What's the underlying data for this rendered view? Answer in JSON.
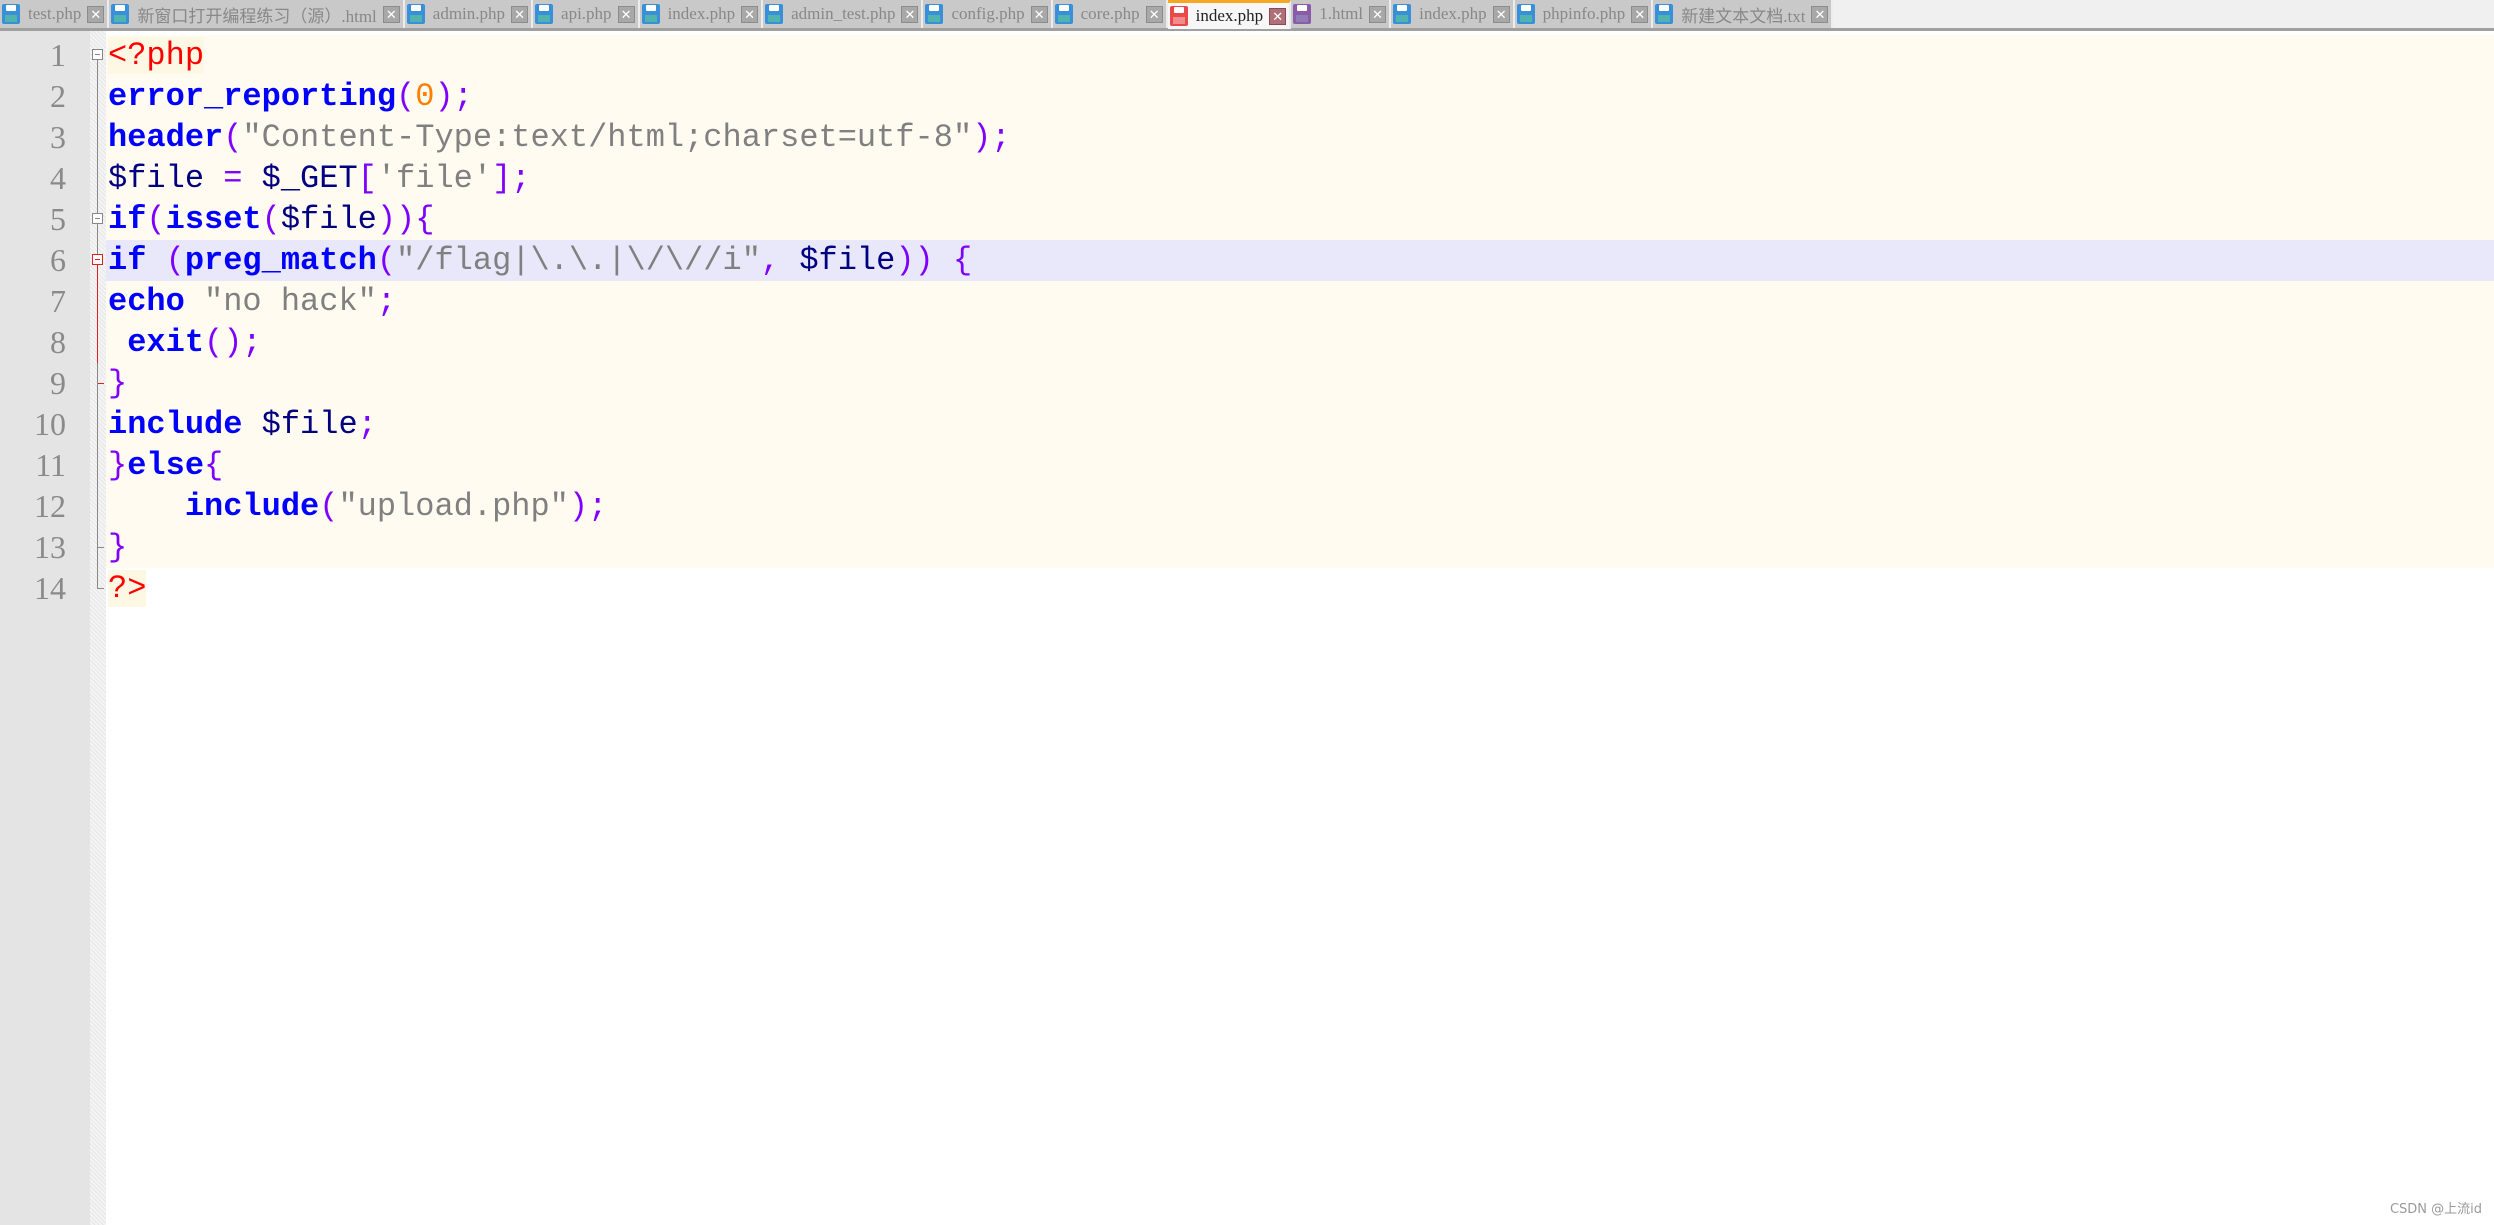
{
  "tabs": [
    {
      "name": "test.php",
      "icon": "floppy-disk-icon",
      "state": "saved"
    },
    {
      "name": "新窗口打开编程练习（源）.html",
      "icon": "floppy-disk-icon",
      "state": "saved"
    },
    {
      "name": "admin.php",
      "icon": "floppy-disk-icon",
      "state": "saved"
    },
    {
      "name": "api.php",
      "icon": "floppy-disk-icon",
      "state": "saved"
    },
    {
      "name": "index.php",
      "icon": "floppy-disk-icon",
      "state": "saved"
    },
    {
      "name": "admin_test.php",
      "icon": "floppy-disk-icon",
      "state": "saved"
    },
    {
      "name": "config.php",
      "icon": "floppy-disk-icon",
      "state": "saved"
    },
    {
      "name": "core.php",
      "icon": "floppy-disk-icon",
      "state": "saved"
    },
    {
      "name": "index.php",
      "icon": "floppy-disk-icon",
      "state": "unsaved-active"
    },
    {
      "name": "1.html",
      "icon": "floppy-disk-icon",
      "state": "readonly"
    },
    {
      "name": "index.php",
      "icon": "floppy-disk-icon",
      "state": "saved"
    },
    {
      "name": "phpinfo.php",
      "icon": "floppy-disk-icon",
      "state": "saved"
    },
    {
      "name": "新建文本文档.txt",
      "icon": "floppy-disk-icon",
      "state": "saved"
    }
  ],
  "active_tab_index": 8,
  "close_glyph": "✕",
  "editor": {
    "current_line": 6,
    "lines": [
      {
        "n": "1",
        "tokens": [
          {
            "t": "<?php",
            "c": "tag"
          }
        ]
      },
      {
        "n": "2",
        "tokens": [
          {
            "t": "error_reporting",
            "c": "kw"
          },
          {
            "t": "(",
            "c": "p"
          },
          {
            "t": "0",
            "c": "num"
          },
          {
            "t": ");",
            "c": "p"
          }
        ]
      },
      {
        "n": "3",
        "tokens": [
          {
            "t": "header",
            "c": "kw"
          },
          {
            "t": "(",
            "c": "p"
          },
          {
            "t": "\"Content-Type:text/html;charset=utf-8\"",
            "c": "str"
          },
          {
            "t": ");",
            "c": "p"
          }
        ]
      },
      {
        "n": "4",
        "tokens": [
          {
            "t": "$file",
            "c": "var"
          },
          {
            "t": " ",
            "c": "var"
          },
          {
            "t": "=",
            "c": "p"
          },
          {
            "t": " $_GET",
            "c": "var"
          },
          {
            "t": "[",
            "c": "p"
          },
          {
            "t": "'file'",
            "c": "sqs"
          },
          {
            "t": "];",
            "c": "p"
          }
        ]
      },
      {
        "n": "5",
        "tokens": [
          {
            "t": "if",
            "c": "kw"
          },
          {
            "t": "(",
            "c": "p"
          },
          {
            "t": "isset",
            "c": "kw"
          },
          {
            "t": "(",
            "c": "p"
          },
          {
            "t": "$file",
            "c": "var"
          },
          {
            "t": ")){",
            "c": "p"
          }
        ]
      },
      {
        "n": "6",
        "tokens": [
          {
            "t": "if",
            "c": "kw"
          },
          {
            "t": " (",
            "c": "p"
          },
          {
            "t": "preg_match",
            "c": "kw"
          },
          {
            "t": "(",
            "c": "p"
          },
          {
            "t": "\"/flag|\\.\\.|\\/\\//i\"",
            "c": "str"
          },
          {
            "t": ",",
            "c": "p"
          },
          {
            "t": " $file",
            "c": "var"
          },
          {
            "t": "))",
            "c": "p"
          },
          {
            "t": " {",
            "c": "p"
          }
        ]
      },
      {
        "n": "7",
        "tokens": [
          {
            "t": "echo",
            "c": "kw"
          },
          {
            "t": " ",
            "c": "var"
          },
          {
            "t": "\"no hack\"",
            "c": "str"
          },
          {
            "t": ";",
            "c": "p"
          }
        ]
      },
      {
        "n": "8",
        "tokens": [
          {
            "t": " ",
            "c": "var"
          },
          {
            "t": "exit",
            "c": "kw"
          },
          {
            "t": "();",
            "c": "p"
          }
        ]
      },
      {
        "n": "9",
        "tokens": [
          {
            "t": "}",
            "c": "p"
          }
        ]
      },
      {
        "n": "10",
        "tokens": [
          {
            "t": "include",
            "c": "kw"
          },
          {
            "t": " $file",
            "c": "var"
          },
          {
            "t": ";",
            "c": "p"
          }
        ]
      },
      {
        "n": "11",
        "tokens": [
          {
            "t": "}",
            "c": "p"
          },
          {
            "t": "else",
            "c": "kw"
          },
          {
            "t": "{",
            "c": "p"
          }
        ]
      },
      {
        "n": "12",
        "tokens": [
          {
            "t": "    ",
            "c": "var"
          },
          {
            "t": "include",
            "c": "kw"
          },
          {
            "t": "(",
            "c": "p"
          },
          {
            "t": "\"upload.php\"",
            "c": "str"
          },
          {
            "t": ");",
            "c": "p"
          }
        ]
      },
      {
        "n": "13",
        "tokens": [
          {
            "t": "}",
            "c": "p"
          }
        ]
      },
      {
        "n": "14",
        "tokens": [
          {
            "t": "?>",
            "c": "tag"
          }
        ]
      }
    ]
  },
  "watermark": "CSDN @上流id"
}
